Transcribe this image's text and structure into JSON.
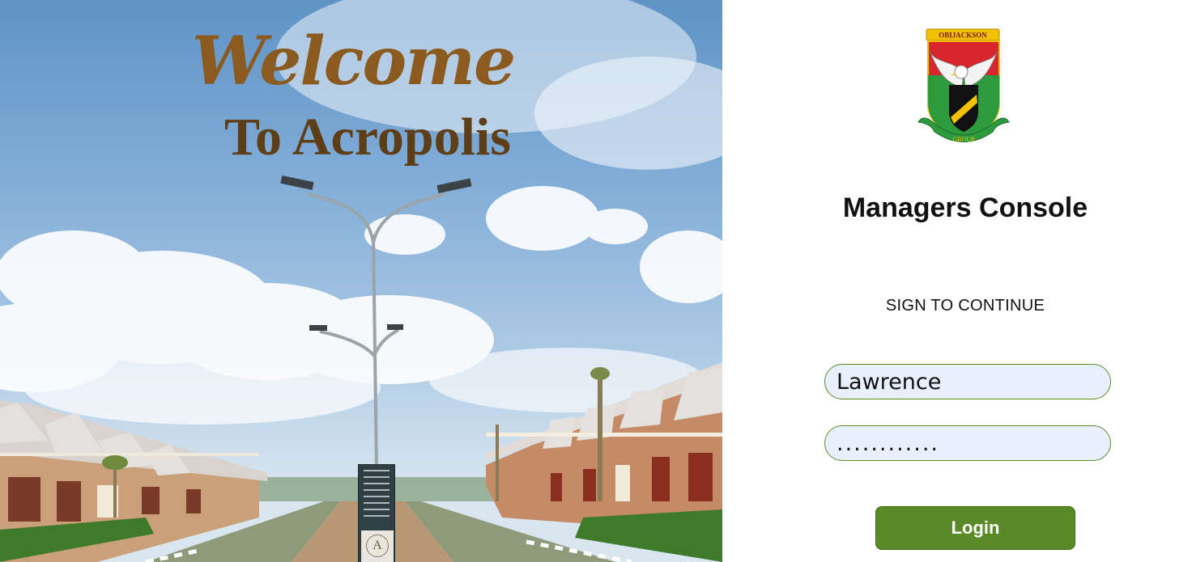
{
  "hero": {
    "welcome_text": "Welcome",
    "subtitle_text": "To Acropolis",
    "sign_letter": "A"
  },
  "brand": {
    "crest_top_text": "OBIJACKSON",
    "crest_bottom_text": "GROUP",
    "logo_icon": "eagle-crest-logo"
  },
  "login": {
    "title": "Managers Console",
    "subtitle": "SIGN TO CONTINUE",
    "username_value": "Lawrence",
    "password_value": "............",
    "button_label": "Login"
  },
  "colors": {
    "accent_green": "#5a8a28",
    "input_fill": "#e8f0fe",
    "welcome_brown": "#8a5a1e"
  }
}
